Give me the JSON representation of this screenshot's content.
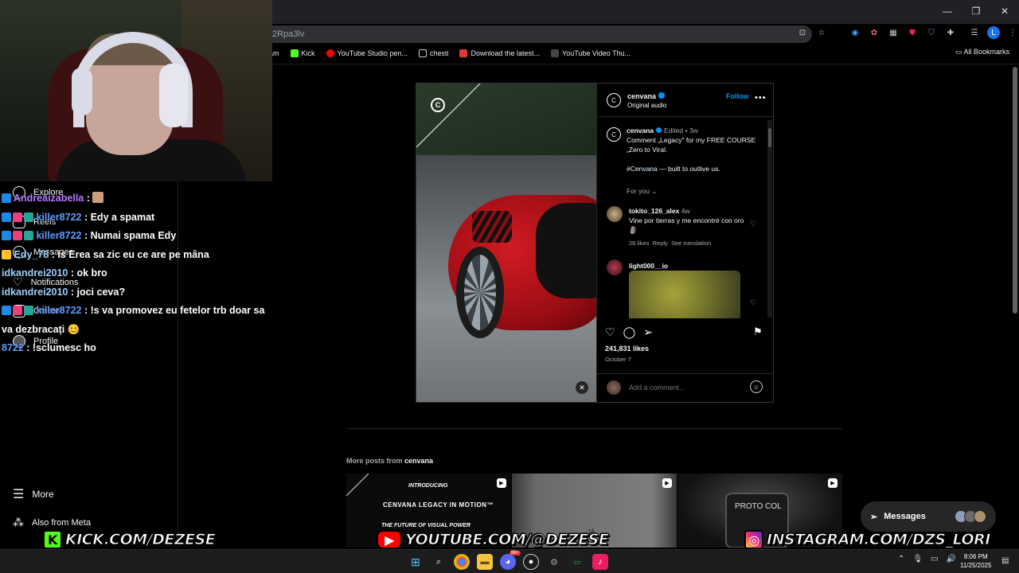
{
  "browser": {
    "address_fragment": "2Rpa3lv",
    "bookmarks": [
      {
        "label": "gram",
        "color": "#c13584"
      },
      {
        "label": "Kick",
        "color": "#53fc18"
      },
      {
        "label": "YouTube Studio pen...",
        "color": "#ff0000"
      },
      {
        "label": "chesti",
        "color": "folder"
      },
      {
        "label": "Download the latest...",
        "color": "#e53935"
      },
      {
        "label": "YouTube Video Thu...",
        "color": "#222222"
      }
    ],
    "all_bookmarks": "All Bookmarks",
    "profile_letter": "L"
  },
  "nav": {
    "explore": "Explore",
    "reels": "Reels",
    "messages": "Messages",
    "notifications": "Notifications",
    "create": "Create",
    "profile": "Profile",
    "more": "More",
    "also_from_meta": "Also from Meta"
  },
  "chat": [
    {
      "user": "Andreaizabella",
      "text": ": ",
      "color": "#b57bff",
      "badges": [
        "#1e88e5"
      ],
      "emote": true
    },
    {
      "user": "killer8722",
      "text": ": Edy a spamat",
      "color": "#5e9cff",
      "badges": [
        "#1e88e5",
        "#ec407a",
        "#26a69a"
      ]
    },
    {
      "user": "killer8722",
      "text": ": Numai spama Edy",
      "color": "#5e9cff",
      "badges": [
        "#1e88e5",
        "#ec407a",
        "#26a69a"
      ]
    },
    {
      "user": "Edy_78",
      "text": ": is Erea sa zic eu ce are pe mâna",
      "color": "#9ad0ff",
      "badges": [
        "#fbc02d"
      ]
    },
    {
      "user": "idkandrei2010",
      "text": ": ok bro",
      "color": "#9ad0ff",
      "badges": []
    },
    {
      "user": "idkandrei2010",
      "text": ": joci ceva?",
      "color": "#9ad0ff",
      "badges": []
    },
    {
      "user": "killer8722",
      "text": ": !s va promovez eu fetelor trb doar sa va dezbracați 😊",
      "color": "#5e9cff",
      "badges": [
        "#1e88e5",
        "#ec407a",
        "#26a69a"
      ]
    },
    {
      "user": "8722",
      "text": ": !sclumesc ho",
      "color": "#5e9cff",
      "badges": []
    }
  ],
  "post": {
    "username": "cenvana",
    "audio": "Original audio",
    "follow": "Follow",
    "caption_user": "cenvana",
    "caption_edited": "Edited",
    "caption_age": "3w",
    "caption_text": "Comment „Legacy\" for my FREE COURSE „Zero to Viral.",
    "caption_hashtag": "#Cenvana",
    "caption_tail": "— built to outlive us.",
    "for_you": "For you",
    "comments": [
      {
        "user": "tokito_126_alex",
        "age": "4w",
        "text": "Vine por tierras y me encontré con oro 🗿",
        "likes": "28 likes",
        "reply": "Reply",
        "translate": "See translation"
      },
      {
        "user": "light000__io",
        "age": "",
        "text": "",
        "likes": "",
        "reply": "",
        "translate": ""
      }
    ],
    "likes": "241,831 likes",
    "date": "October 7",
    "comment_placeholder": "Add a comment..."
  },
  "more_posts": {
    "prefix": "More posts from",
    "user": "cenvana",
    "thumb1": {
      "line1": "INTRODUCING",
      "line2": "CENVANA LEGACY IN MOTION™",
      "line3": "THE FUTURE OF VISUAL POWER"
    },
    "thumb2": {
      "line1": "IA"
    },
    "thumb3": {
      "line1": "PROTO COL"
    }
  },
  "messages_pill": "Messages",
  "banners": {
    "kick": "KICK.COM/DEZESE",
    "youtube": "YOUTUBE.COM/@DEZESE",
    "instagram": "INSTAGRAM.COM/DZS_LORI"
  },
  "taskbar": {
    "time": "8:06 PM",
    "date": "11/25/2025",
    "discord_badge": "99+"
  },
  "colors": {
    "ig_blue": "#0095f6",
    "kick_green": "#53fc18",
    "youtube_red": "#ff0000"
  }
}
